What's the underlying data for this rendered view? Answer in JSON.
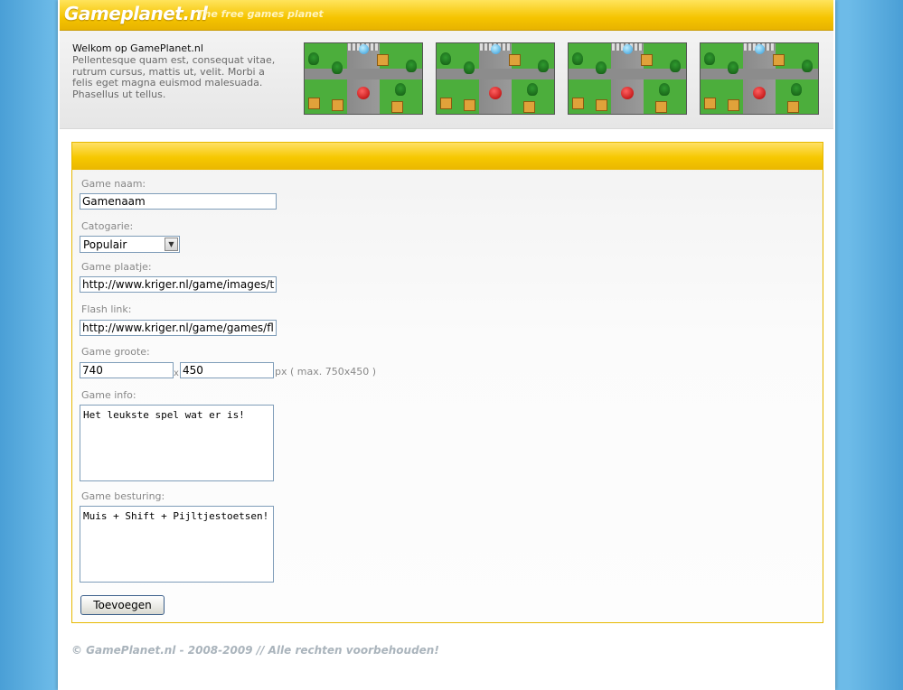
{
  "header": {
    "logo": "Gameplanet.nl",
    "tagline": "The free games planet",
    "welcome_title": "Welkom op GamePlanet.nl",
    "welcome_text": "Pellentesque quam est, consequat vitae, rutrum cursus, mattis ut, velit. Morbi a felis eget magna euismod malesuada. Phasellus ut tellus."
  },
  "form": {
    "name_label": "Game naam:",
    "name_value": "Gamenaam",
    "category_label": "Catogarie:",
    "category_value": "Populair",
    "image_label": "Game plaatje:",
    "image_value": "http://www.kriger.nl/game/images/te",
    "flash_label": "Flash link:",
    "flash_value": "http://www.kriger.nl/game/games/fla",
    "size_label": "Game groote:",
    "width_value": "740",
    "size_separator": "x",
    "height_value": "450",
    "size_hint": "px ( max. 750x450 )",
    "info_label": "Game info:",
    "info_value": "Het leukste spel wat er is!",
    "controls_label": "Game besturing:",
    "controls_value": "Muis + Shift + Pijltjestoetsen!",
    "submit_label": "Toevoegen"
  },
  "footer": {
    "text": "© GamePlanet.nl - 2008-2009 // Alle rechten voorbehouden!"
  },
  "colors": {
    "accent": "#f5c400",
    "background": "#6dbbe8"
  }
}
